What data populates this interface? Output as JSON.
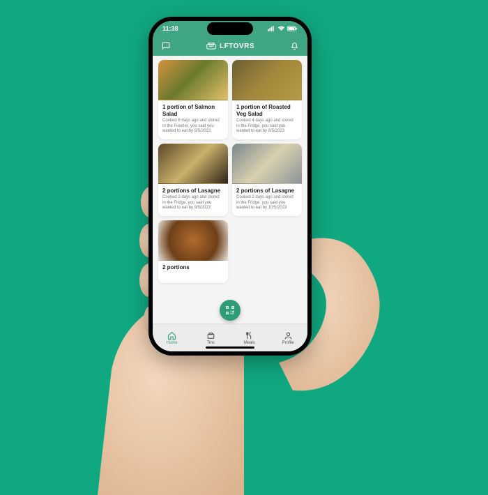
{
  "statusbar": {
    "time": "11:38"
  },
  "appbar": {
    "title": "LFTOVRS"
  },
  "cards": [
    {
      "title": "1 portion of Salmon Salad",
      "sub": "Cooked 6 days ago and stored in the Freezer, you said you wanted to eat by 9/5/2023",
      "img": "img-salmon"
    },
    {
      "title": "1 portion of Roasted Veg Salad",
      "sub": "Cooked 4 days ago and stored in the Fridge, you said you wanted to eat by 8/5/2023",
      "img": "img-veg"
    },
    {
      "title": "2 portions of Lasagne",
      "sub": "Cooked 2 days ago and stored in the Fridge, you said you wanted to eat by 9/5/2023",
      "img": "img-las1"
    },
    {
      "title": "2 portions of Lasagne",
      "sub": "Cooked 2 days ago and stored in the Fridge, you said you wanted to eat by 10/5/2023",
      "img": "img-las2"
    },
    {
      "title": "2 portions",
      "sub": "",
      "img": "img-curry"
    }
  ],
  "nav": {
    "items": [
      {
        "label": "Home"
      },
      {
        "label": "Tins"
      },
      {
        "label": "Meals"
      },
      {
        "label": "Profile"
      }
    ]
  }
}
